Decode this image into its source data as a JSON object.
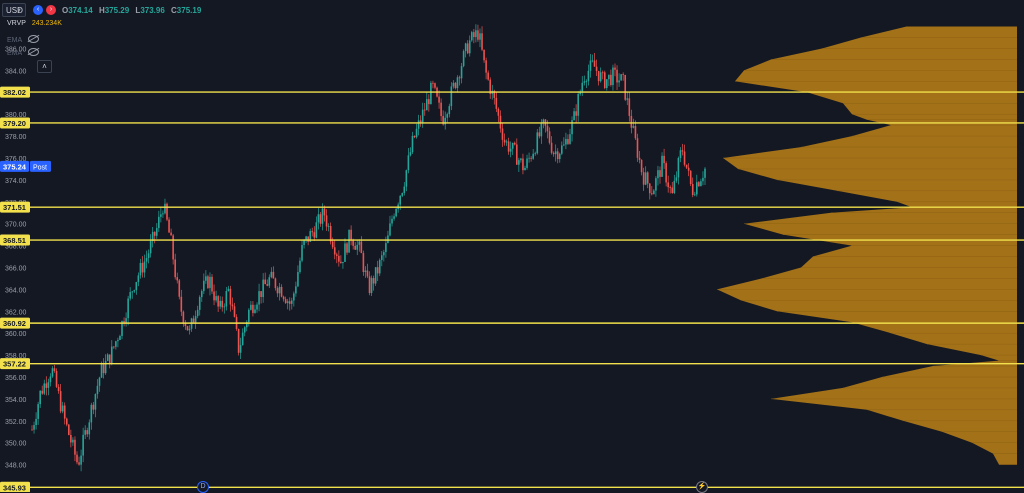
{
  "toolbar": {
    "currency": "USD",
    "ohlc": {
      "o_label": "O",
      "o": "374.14",
      "h_label": "H",
      "h": "375.29",
      "l_label": "L",
      "l": "373.96",
      "c_label": "C",
      "c": "375.19"
    },
    "indicators": [
      {
        "name": "VRVP",
        "value": "243.234K"
      },
      {
        "name": "EMA",
        "value": ""
      },
      {
        "name": "EMA",
        "value": ""
      }
    ],
    "collapse_glyph": "˄",
    "nav_left_glyph": "‹",
    "nav_right_glyph": "›"
  },
  "markers": {
    "dividend": "D",
    "earnings": "⚡"
  },
  "colors": {
    "background": "#141823",
    "up": "#26a69a",
    "down": "#ef5350",
    "level": "#f2e14c",
    "profile": "#b07a18",
    "post_badge": "#2962ff"
  },
  "chart_data": {
    "type": "candlestick",
    "symbol_currency": "USD",
    "ylim": [
      347.0,
      389.0
    ],
    "y_ticks": [
      "386.00",
      "384.00",
      "382.00",
      "380.00",
      "378.00",
      "376.00",
      "374.00",
      "372.00",
      "370.00",
      "368.00",
      "366.00",
      "364.00",
      "362.00",
      "360.00",
      "358.00",
      "356.00",
      "354.00",
      "352.00",
      "350.00",
      "348.00"
    ],
    "last_price": {
      "value": "375.24",
      "session": "Post"
    },
    "levels": [
      {
        "label": "382.02",
        "value": 382.02
      },
      {
        "label": "379.20",
        "value": 379.2
      },
      {
        "label": "371.51",
        "value": 371.51
      },
      {
        "label": "368.51",
        "value": 368.51
      },
      {
        "label": "360.92",
        "value": 360.92
      },
      {
        "label": "357.22",
        "value": 357.22
      },
      {
        "label": "345.93",
        "value": 345.93
      }
    ],
    "price_path": [
      [
        0,
        351.2
      ],
      [
        5,
        354.5
      ],
      [
        12,
        356.8
      ],
      [
        20,
        352.0
      ],
      [
        28,
        348.0
      ],
      [
        36,
        353.0
      ],
      [
        42,
        356.5
      ],
      [
        48,
        358.0
      ],
      [
        54,
        360.5
      ],
      [
        62,
        364.5
      ],
      [
        70,
        367.0
      ],
      [
        76,
        369.5
      ],
      [
        80,
        371.8
      ],
      [
        85,
        368.0
      ],
      [
        90,
        362.5
      ],
      [
        96,
        360.0
      ],
      [
        102,
        363.5
      ],
      [
        108,
        365.0
      ],
      [
        114,
        362.0
      ],
      [
        120,
        364.0
      ],
      [
        126,
        358.5
      ],
      [
        132,
        362.0
      ],
      [
        138,
        363.5
      ],
      [
        145,
        365.0
      ],
      [
        152,
        364.0
      ],
      [
        158,
        362.5
      ],
      [
        165,
        368.0
      ],
      [
        172,
        369.5
      ],
      [
        178,
        371.0
      ],
      [
        182,
        369.0
      ],
      [
        188,
        366.5
      ],
      [
        194,
        369.0
      ],
      [
        200,
        367.5
      ],
      [
        205,
        364.0
      ],
      [
        210,
        365.5
      ],
      [
        216,
        368.0
      ],
      [
        220,
        371.0
      ],
      [
        226,
        373.5
      ],
      [
        232,
        377.5
      ],
      [
        238,
        380.0
      ],
      [
        244,
        382.5
      ],
      [
        250,
        379.5
      ],
      [
        258,
        383.0
      ],
      [
        266,
        386.5
      ],
      [
        272,
        387.5
      ],
      [
        276,
        384.0
      ],
      [
        282,
        381.0
      ],
      [
        288,
        377.5
      ],
      [
        294,
        376.5
      ],
      [
        300,
        375.0
      ],
      [
        306,
        377.0
      ],
      [
        312,
        379.0
      ],
      [
        318,
        376.5
      ],
      [
        324,
        377.0
      ],
      [
        330,
        379.5
      ],
      [
        336,
        383.5
      ],
      [
        342,
        384.5
      ],
      [
        348,
        383.0
      ],
      [
        354,
        383.5
      ],
      [
        360,
        383.0
      ],
      [
        366,
        378.5
      ],
      [
        372,
        374.5
      ],
      [
        378,
        373.0
      ],
      [
        384,
        375.5
      ],
      [
        390,
        372.5
      ],
      [
        396,
        377.0
      ],
      [
        402,
        373.0
      ],
      [
        406,
        374.0
      ],
      [
        410,
        375.0
      ]
    ],
    "x_range": [
      0,
      410
    ],
    "volume_profile": [
      [
        388.0,
        0.37
      ],
      [
        387.0,
        0.52
      ],
      [
        386.0,
        0.65
      ],
      [
        385.0,
        0.82
      ],
      [
        384.0,
        0.91
      ],
      [
        383.0,
        0.94
      ],
      [
        382.0,
        0.7
      ],
      [
        381.0,
        0.58
      ],
      [
        380.0,
        0.55
      ],
      [
        379.5,
        0.5
      ],
      [
        379.0,
        0.42
      ],
      [
        378.0,
        0.55
      ],
      [
        377.0,
        0.72
      ],
      [
        376.0,
        0.98
      ],
      [
        375.0,
        0.93
      ],
      [
        374.0,
        0.8
      ],
      [
        373.0,
        0.6
      ],
      [
        372.0,
        0.4
      ],
      [
        371.5,
        0.35
      ],
      [
        371.0,
        0.62
      ],
      [
        370.0,
        0.91
      ],
      [
        369.0,
        0.78
      ],
      [
        368.0,
        0.55
      ],
      [
        367.0,
        0.68
      ],
      [
        366.0,
        0.72
      ],
      [
        365.0,
        0.85
      ],
      [
        364.0,
        1.0
      ],
      [
        363.0,
        0.92
      ],
      [
        362.0,
        0.8
      ],
      [
        361.0,
        0.55
      ],
      [
        360.0,
        0.42
      ],
      [
        359.0,
        0.3
      ],
      [
        358.0,
        0.12
      ],
      [
        357.5,
        0.06
      ],
      [
        357.0,
        0.28
      ],
      [
        356.0,
        0.45
      ],
      [
        355.0,
        0.58
      ],
      [
        354.0,
        0.82
      ],
      [
        353.0,
        0.5
      ],
      [
        352.0,
        0.38
      ],
      [
        351.0,
        0.25
      ],
      [
        350.0,
        0.15
      ],
      [
        349.0,
        0.08
      ],
      [
        348.0,
        0.06
      ]
    ]
  }
}
